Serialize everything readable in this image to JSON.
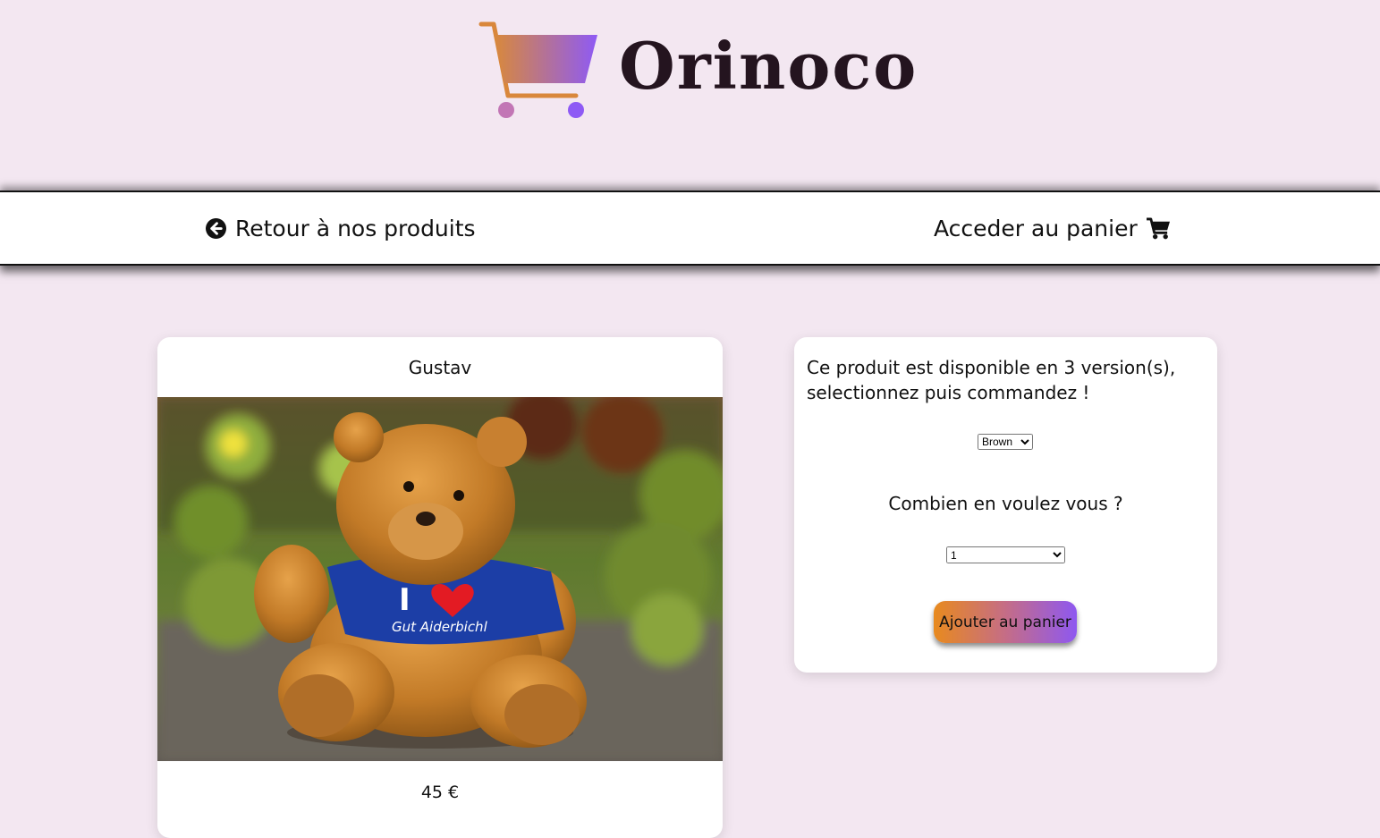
{
  "brand": {
    "name": "Orinoco",
    "icon": "shopping-cart-logo-icon"
  },
  "nav": {
    "back_label": "Retour à nos produits",
    "back_icon": "arrow-circle-left-icon",
    "cart_label": "Acceder au panier",
    "cart_icon": "shopping-cart-icon"
  },
  "product": {
    "name": "Gustav",
    "price": "45 €",
    "image": "teddy-bear-photo"
  },
  "options": {
    "availability_text": "Ce produit est disponible en 3 version(s), selectionnez puis commandez !",
    "color_selected": "Brown",
    "quantity_label": "Combien en voulez vous ?",
    "quantity_selected": "1",
    "add_button_label": "Ajouter au panier"
  },
  "colors": {
    "background": "#f3e7f1",
    "gradient_start": "#e88a1e",
    "gradient_end": "#8e58f0"
  }
}
